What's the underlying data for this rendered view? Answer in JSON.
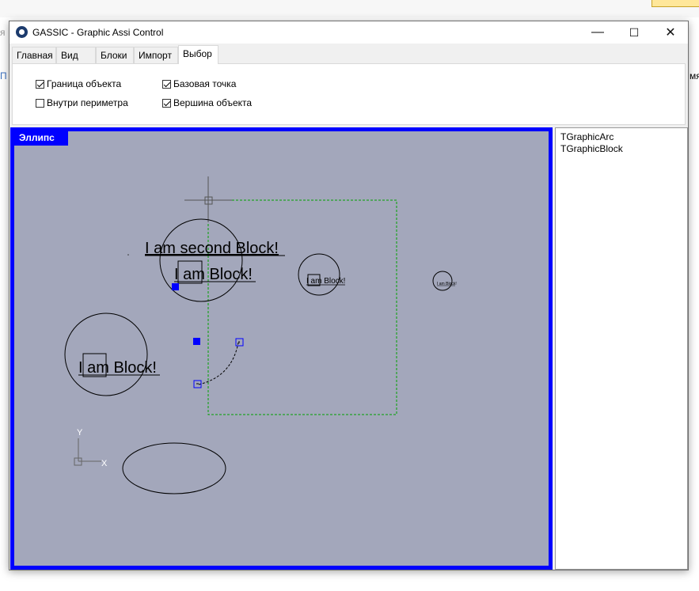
{
  "window": {
    "title": "GASSIC - Graphic Assi Control",
    "minimize": "—",
    "maximize": "☐",
    "close": "✕"
  },
  "background": {
    "left_char": "я",
    "left_char2": "П",
    "right_label": "мя"
  },
  "tabs": [
    {
      "label": "Главная",
      "active": false
    },
    {
      "label": "Вид",
      "active": false
    },
    {
      "label": "Блоки",
      "active": false
    },
    {
      "label": "Импорт",
      "active": false
    },
    {
      "label": "Выбор",
      "active": true
    }
  ],
  "options": {
    "object_border": {
      "label": "Граница объекта",
      "checked": true
    },
    "base_point": {
      "label": "Базовая точка",
      "checked": true
    },
    "inside_perimeter": {
      "label": "Внутри периметра",
      "checked": false
    },
    "object_vertex": {
      "label": "Вершина объекта",
      "checked": true
    }
  },
  "canvas": {
    "selected_label": "Эллипс",
    "block_text_1": "I am second Block!",
    "block_text_2": "I am Block!",
    "block_text_3": "I am Block!",
    "block_text_small": "I am Block!",
    "block_text_tiny": "I am Block!",
    "axis_x": "X",
    "axis_y": "Y",
    "colors": {
      "background": "#a3a7bb",
      "selection_border": "#0000ff",
      "selection_rect": "#00a000",
      "grip": "#0000ff"
    }
  },
  "object_list": [
    "TGraphicArc",
    "TGraphicBlock"
  ]
}
